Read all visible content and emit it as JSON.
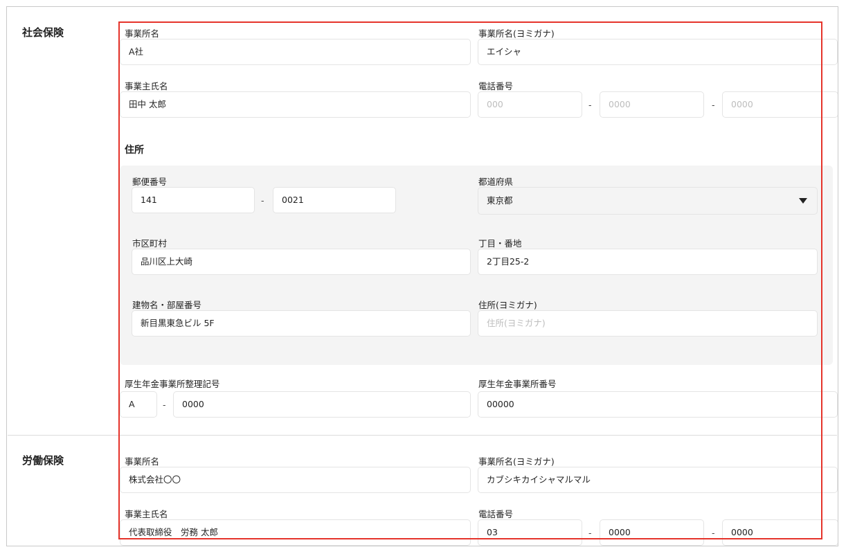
{
  "social_insurance": {
    "section_title": "社会保険",
    "office_name": {
      "label": "事業所名",
      "value": "A社"
    },
    "office_name_kana": {
      "label": "事業所名(ヨミガナ)",
      "value": "エイシャ"
    },
    "owner_name": {
      "label": "事業主氏名",
      "value": "田中 太郎"
    },
    "phone": {
      "label": "電話番号",
      "part1_placeholder": "000",
      "part2_placeholder": "0000",
      "part3_placeholder": "0000",
      "dash": "-"
    },
    "address": {
      "heading": "住所",
      "postal": {
        "label": "郵便番号",
        "part1": "141",
        "part2": "0021",
        "dash": "-"
      },
      "prefecture": {
        "label": "都道府県",
        "value": "東京都"
      },
      "city": {
        "label": "市区町村",
        "value": "品川区上大崎"
      },
      "street": {
        "label": "丁目・番地",
        "value": "2丁目25-2"
      },
      "building": {
        "label": "建物名・部屋番号",
        "value": "新目黒東急ビル 5F"
      },
      "address_kana": {
        "label": "住所(ヨミガナ)",
        "placeholder": "住所(ヨミガナ)"
      }
    },
    "pension_office_code": {
      "label": "厚生年金事業所整理記号",
      "part1": "A",
      "part2": "0000",
      "dash": "-"
    },
    "pension_office_number": {
      "label": "厚生年金事業所番号",
      "value": "00000"
    }
  },
  "labor_insurance": {
    "section_title": "労働保険",
    "office_name": {
      "label": "事業所名",
      "value": "株式会社〇〇"
    },
    "office_name_kana": {
      "label": "事業所名(ヨミガナ)",
      "value": "カブシキカイシャマルマル"
    },
    "owner_name": {
      "label": "事業主氏名",
      "value": "代表取締役　労務 太郎"
    },
    "phone": {
      "label": "電話番号",
      "part1": "03",
      "part2": "0000",
      "part3": "0000",
      "dash": "-"
    }
  },
  "colors": {
    "highlight": "#e5332a",
    "panel": "#f4f4f4",
    "border": "#e4e4e4"
  }
}
